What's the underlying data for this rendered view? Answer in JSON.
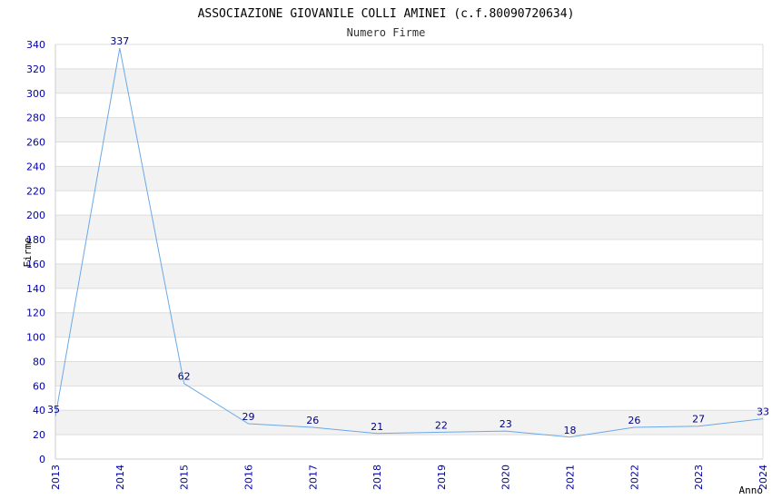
{
  "chart_data": {
    "type": "line",
    "title": "ASSOCIAZIONE GIOVANILE COLLI AMINEI (c.f.80090720634)",
    "subtitle": "Numero Firme",
    "xlabel": "Anno",
    "ylabel": "Firme",
    "x": [
      "2013",
      "2014",
      "2015",
      "2016",
      "2017",
      "2018",
      "2019",
      "2020",
      "2021",
      "2022",
      "2023",
      "2024"
    ],
    "series": [
      {
        "values": [
          35,
          337,
          62,
          29,
          26,
          21,
          22,
          23,
          18,
          26,
          27,
          33
        ]
      }
    ],
    "ylim": [
      0,
      340
    ],
    "ytick_step": 20,
    "grid": true,
    "colors": {
      "line": "#6aa8e8",
      "band": "#f2f2f2",
      "gridline": "#dddddd",
      "tick_text": "#0000aa",
      "data_label": "#000080"
    }
  }
}
